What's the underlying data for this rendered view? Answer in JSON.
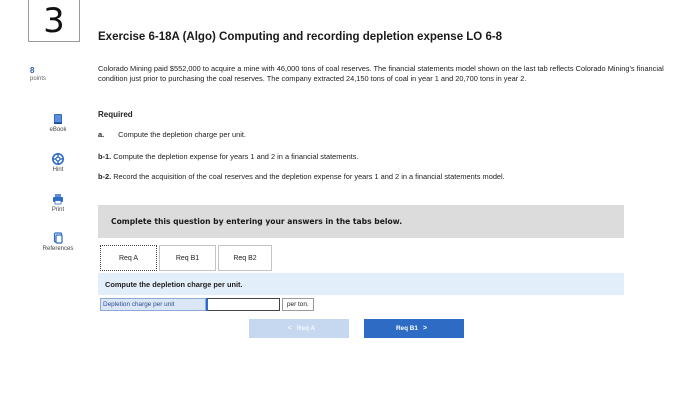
{
  "question": {
    "number": "3",
    "points_value": "8",
    "points_label": "points"
  },
  "tools": [
    {
      "label": "eBook",
      "icon": "book-icon"
    },
    {
      "label": "Hint",
      "icon": "lifebuoy-icon"
    },
    {
      "label": "Print",
      "icon": "printer-icon"
    },
    {
      "label": "References",
      "icon": "references-icon"
    }
  ],
  "exercise": {
    "title": "Exercise 6-18A (Algo) Computing and recording depletion expense LO 6-8",
    "intro": "Colorado Mining paid $552,000 to acquire a mine with 46,000 tons of coal reserves. The financial statements model shown on the last tab reflects Colorado Mining's financial condition just prior to purchasing the coal reserves. The company extracted 24,150 tons of coal in year 1 and 20,700 tons in year 2."
  },
  "required": {
    "heading": "Required",
    "items": [
      {
        "tag": "a.",
        "text": "Compute the depletion charge per unit."
      },
      {
        "tag": "b-1.",
        "text": "Compute the depletion expense for years 1 and 2 in a financial statements."
      },
      {
        "tag": "b-2.",
        "text": "Record the acquisition of the coal reserves and the depletion expense for years 1 and 2 in a financial statements model."
      }
    ]
  },
  "instructions": "Complete this question by entering your answers in the tabs below.",
  "tabs": [
    {
      "label": "Req A",
      "active": true
    },
    {
      "label": "Req B1",
      "active": false
    },
    {
      "label": "Req B2",
      "active": false
    }
  ],
  "panel": {
    "prompt": "Compute the depletion charge per unit.",
    "answer_label": "Depletion charge per unit",
    "answer_value": "",
    "answer_unit": "per ton."
  },
  "nav": {
    "prev_label": "Req A",
    "prev_arrow": "<",
    "next_label": "Req B1",
    "next_arrow": ">"
  },
  "colors": {
    "accent": "#2d6bc4",
    "disabled": "#c6d8f0",
    "panel_bg": "#e2eefa",
    "instruction_bg": "#dcdcdc"
  }
}
